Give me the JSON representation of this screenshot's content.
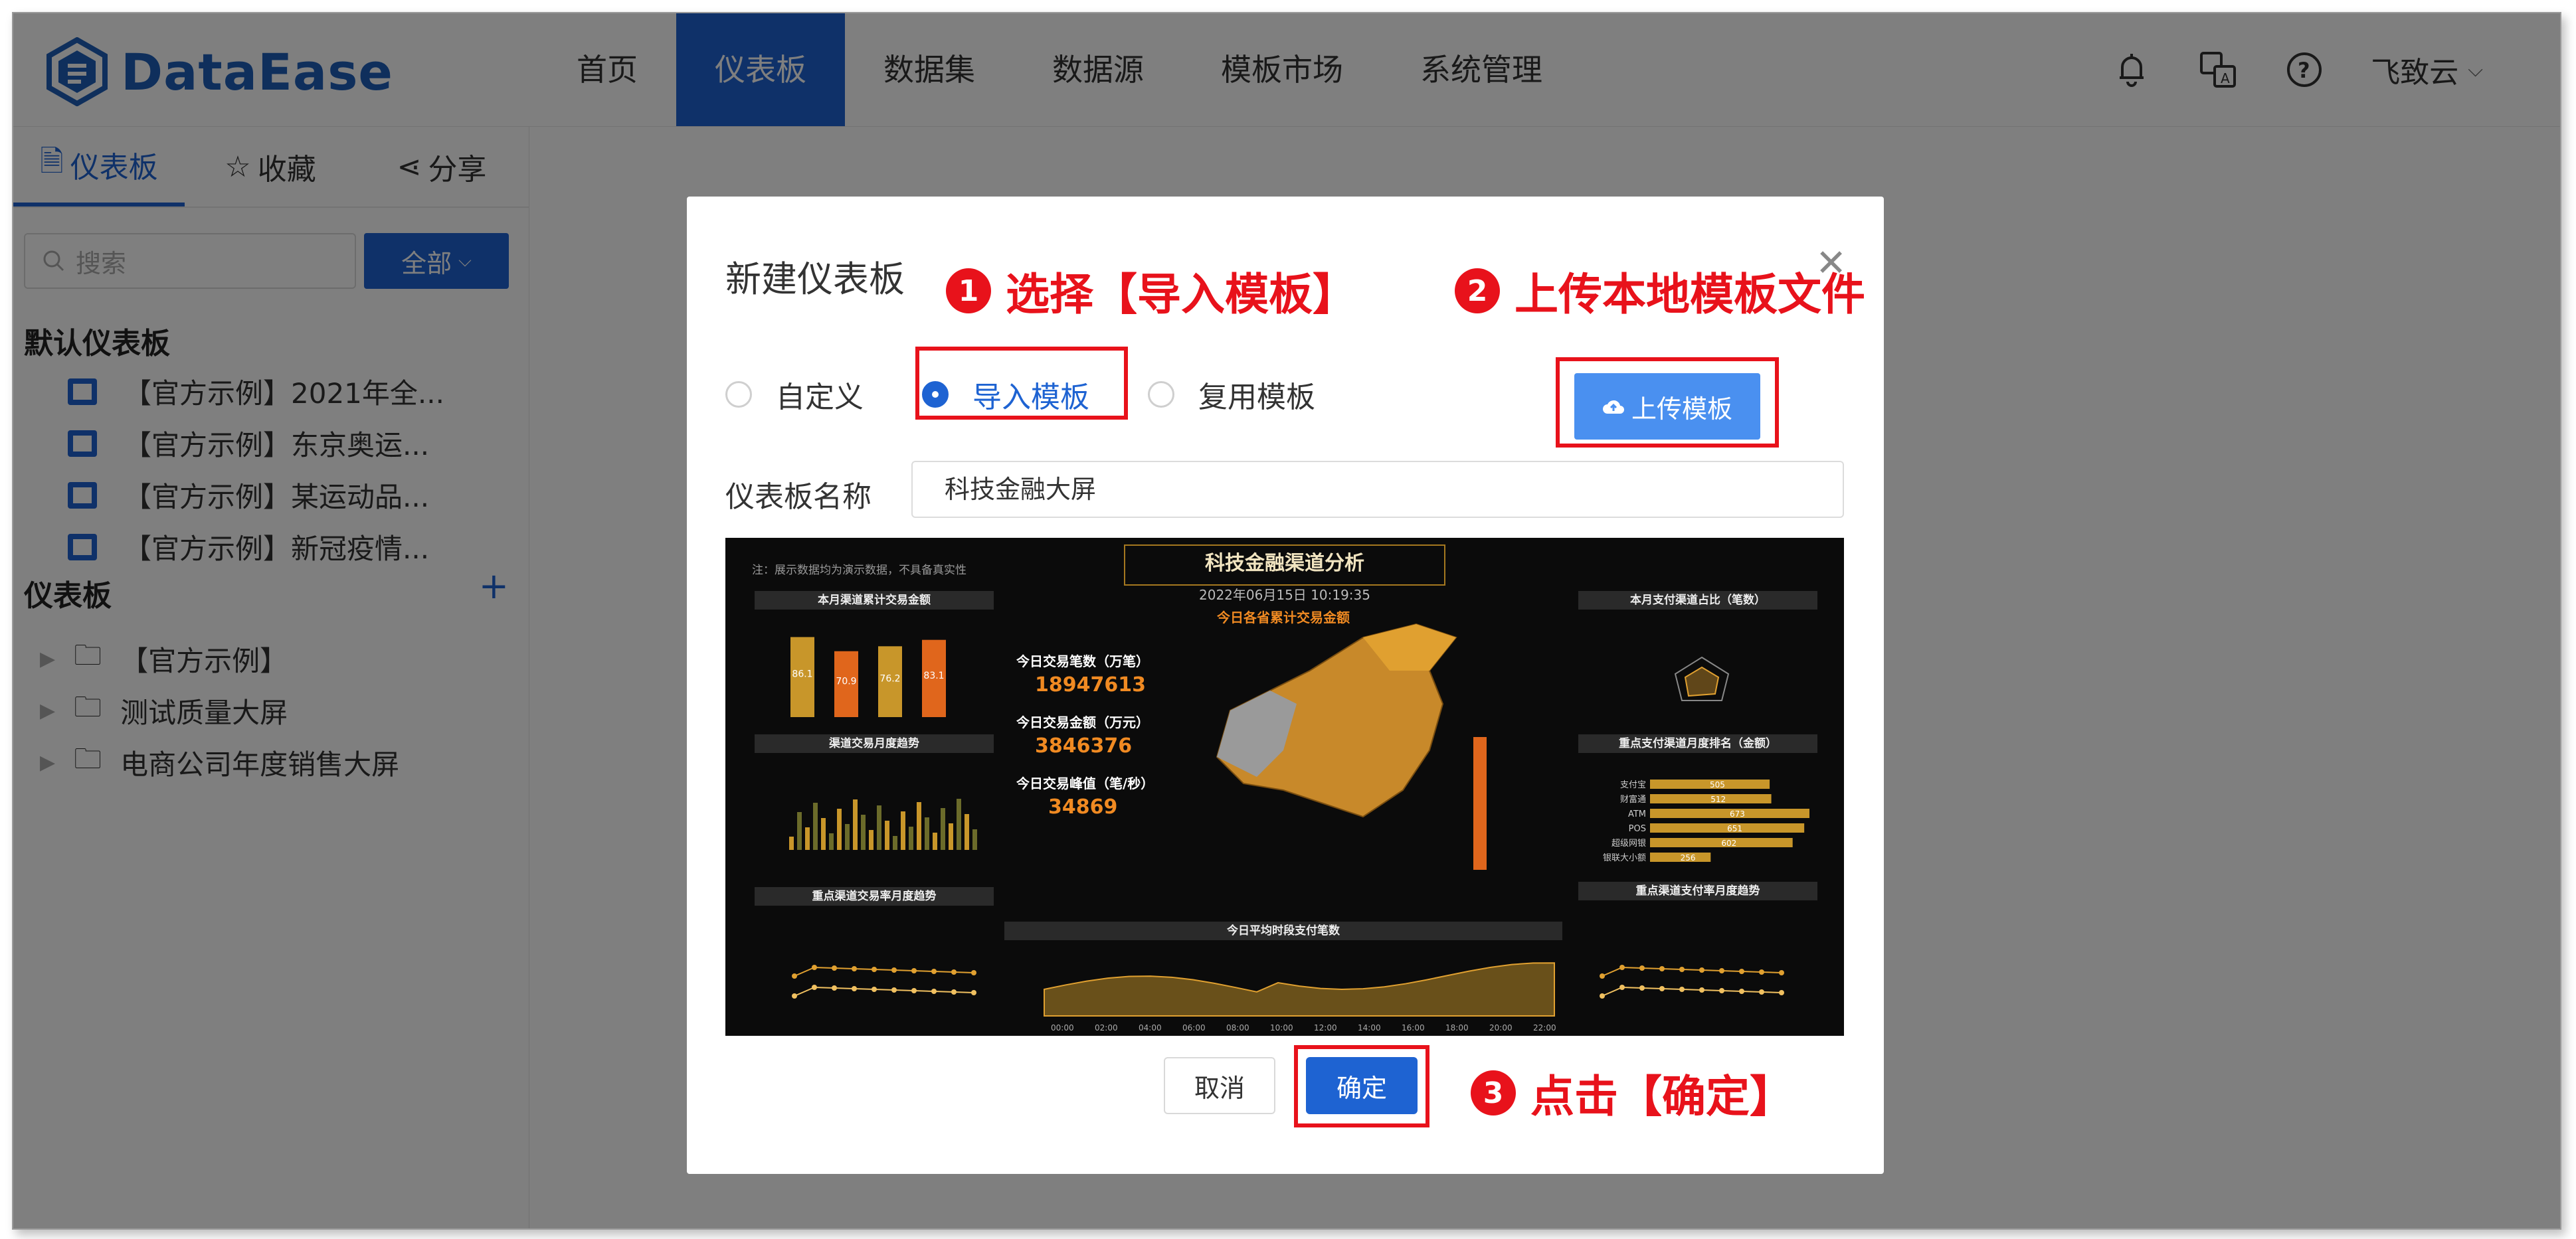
{
  "app": {
    "logo_text": "DataEase",
    "nav": [
      "首页",
      "仪表板",
      "数据集",
      "数据源",
      "模板市场",
      "系统管理"
    ],
    "active_nav_index": 1,
    "user_name": "飞致云",
    "accent_color": "#1e63d2"
  },
  "sidebar": {
    "tabs": [
      "仪表板",
      "收藏",
      "分享"
    ],
    "search_placeholder": "搜索",
    "filter_label": "全部",
    "default_section_title": "默认仪表板",
    "default_items": [
      "【官方示例】2021年全...",
      "【官方示例】东京奥运...",
      "【官方示例】某运动品...",
      "【官方示例】新冠疫情..."
    ],
    "section_title": "仪表板",
    "folders": [
      "【官方示例】",
      "测试质量大屏",
      "电商公司年度销售大屏"
    ]
  },
  "dialog": {
    "title": "新建仪表板",
    "radio_options": [
      "自定义",
      "导入模板",
      "复用模板"
    ],
    "selected_option_index": 1,
    "upload_label": "上传模板",
    "name_label": "仪表板名称",
    "name_value": "科技金融大屏",
    "cancel_label": "取消",
    "ok_label": "确定"
  },
  "annotations": {
    "step1_num": "1",
    "step1_text": "选择【导入模板】",
    "step2_num": "2",
    "step2_text": "上传本地模板文件",
    "step3_num": "3",
    "step3_text": "点击【确定】",
    "highlight_color": "#e8121b"
  },
  "preview": {
    "title": "科技金融渠道分析",
    "datetime": "2022年06月15日 10:19:35",
    "note": "注：展示数据均为演示数据，不具备真实性",
    "map_title": "今日各省累计交易金额",
    "panels": [
      "本月渠道累计交易金额",
      "渠道交易月度趋势",
      "重点渠道交易率月度趋势",
      "本月支付渠道占比（笔数）",
      "重点支付渠道月度排名（金额）",
      "重点渠道支付率月度趋势",
      "今日平均时段支付笔数"
    ],
    "kpis": [
      {
        "label": "今日交易笔数（万笔）",
        "value": "18947613"
      },
      {
        "label": "今日交易金额（万元）",
        "value": "3846376"
      },
      {
        "label": "今日交易峰值（笔/秒）",
        "value": "34869"
      }
    ],
    "bar_values": [
      86.1,
      70.9,
      76.2,
      83.1
    ],
    "ranking_labels": [
      "支付宝",
      "财富通",
      "ATM",
      "POS",
      "超级网银",
      "银联大小额"
    ],
    "ranking_values": [
      505,
      512,
      673,
      651,
      602,
      256
    ],
    "hour_labels": [
      "00:00",
      "02:00",
      "04:00",
      "06:00",
      "08:00",
      "10:00",
      "12:00",
      "14:00",
      "16:00",
      "18:00",
      "20:00",
      "22:00"
    ]
  }
}
